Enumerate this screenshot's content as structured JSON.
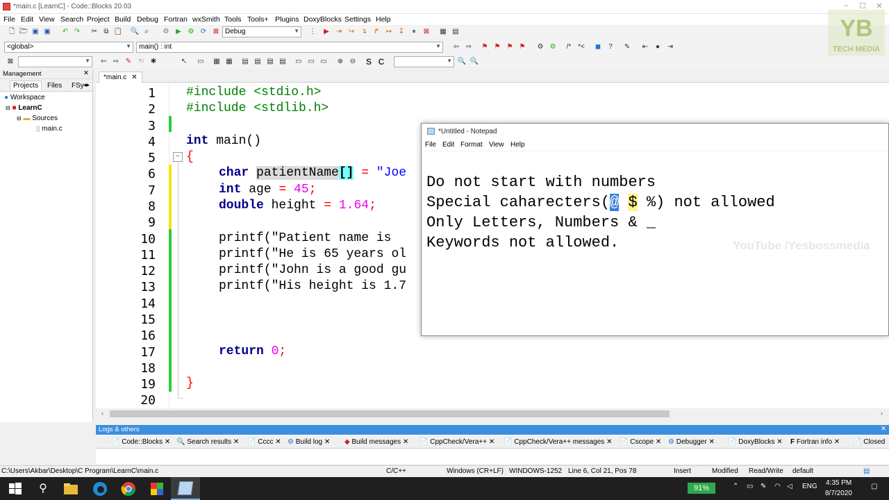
{
  "app": {
    "title": "*main.c [LearnC] - Code::Blocks 20.03",
    "menu": [
      "File",
      "Edit",
      "View",
      "Search",
      "Project",
      "Build",
      "Debug",
      "Fortran",
      "wxSmith",
      "Tools",
      "Tools+",
      "Plugins",
      "DoxyBlocks",
      "Settings",
      "Help"
    ]
  },
  "toolbar": {
    "build_target": "Debug",
    "scope": "<global>",
    "function": "main() : int"
  },
  "management": {
    "title": "Management",
    "tabs": [
      "Projects",
      "Files",
      "FSy"
    ],
    "tree": [
      "Workspace",
      "LearnC",
      "Sources",
      "main.c"
    ]
  },
  "editor": {
    "tab_label": "*main.c",
    "line_numbers": [
      "1",
      "2",
      "3",
      "4",
      "5",
      "6",
      "7",
      "8",
      "9",
      "10",
      "11",
      "12",
      "13",
      "14",
      "15",
      "16",
      "17",
      "18",
      "19",
      "20"
    ],
    "lines": {
      "l1": "#include <stdio.h>",
      "l2": "#include <stdlib.h>",
      "l4_kw": "int",
      "l4_rest": " main()",
      "l5": "{",
      "l6_kw": "char",
      "l6_id": "patientName",
      "l6_br": "[]",
      "l6_eq": " = ",
      "l6_str": "\"Joe",
      "l7_kw": "int",
      "l7_rest": " age ",
      "l7_eq": "=",
      "l7_num": " 45",
      "l7_end": ";",
      "l8_kw": "double",
      "l8_rest": " height ",
      "l8_eq": "=",
      "l8_num": " 1.64",
      "l8_end": ";",
      "l10": "printf(\"Patient name is ",
      "l11": "printf(\"He is 65 years ol",
      "l12": "printf(\"John is a good gu",
      "l13": "printf(\"His height is 1.7",
      "l17_kw": "return",
      "l17_num": " 0",
      "l17_end": ";",
      "l19": "}"
    }
  },
  "notepad": {
    "title": "*Untitled - Notepad",
    "menu": [
      "File",
      "Edit",
      "Format",
      "View",
      "Help"
    ],
    "line1": "Do not start with numbers",
    "line2_a": "Special caharecters(",
    "line2_at": "@",
    "line2_b": " ",
    "line2_dollar": "$",
    "line2_c": " %) not allowed",
    "line3": "Only Letters, Numbers & _",
    "line4": "Keywords not allowed.",
    "watermark": "YouTube /Yesbossmedia"
  },
  "logs": {
    "title": "Logs & others",
    "tabs": [
      "Code::Blocks",
      "Search results",
      "Cccc",
      "Build log",
      "Build messages",
      "CppCheck/Vera++",
      "CppCheck/Vera++ messages",
      "Cscope",
      "Debugger",
      "DoxyBlocks",
      "Fortran info",
      "Closed"
    ]
  },
  "status": {
    "path": "C:\\Users\\Akbar\\Desktop\\C Program\\LearnC\\main.c",
    "lang": "C/C++",
    "eol": "Windows (CR+LF)",
    "encoding": "WINDOWS-1252",
    "position": "Line 6, Col 21, Pos 78",
    "mode": "Insert",
    "modified": "Modified",
    "rw": "Read/Write",
    "profile": "default"
  },
  "taskbar": {
    "battery": "91%",
    "lang": "ENG",
    "time": "4:35 PM",
    "date": "8/7/2020"
  },
  "logo": {
    "letters": "YB",
    "text": "TECH MEDIA"
  }
}
